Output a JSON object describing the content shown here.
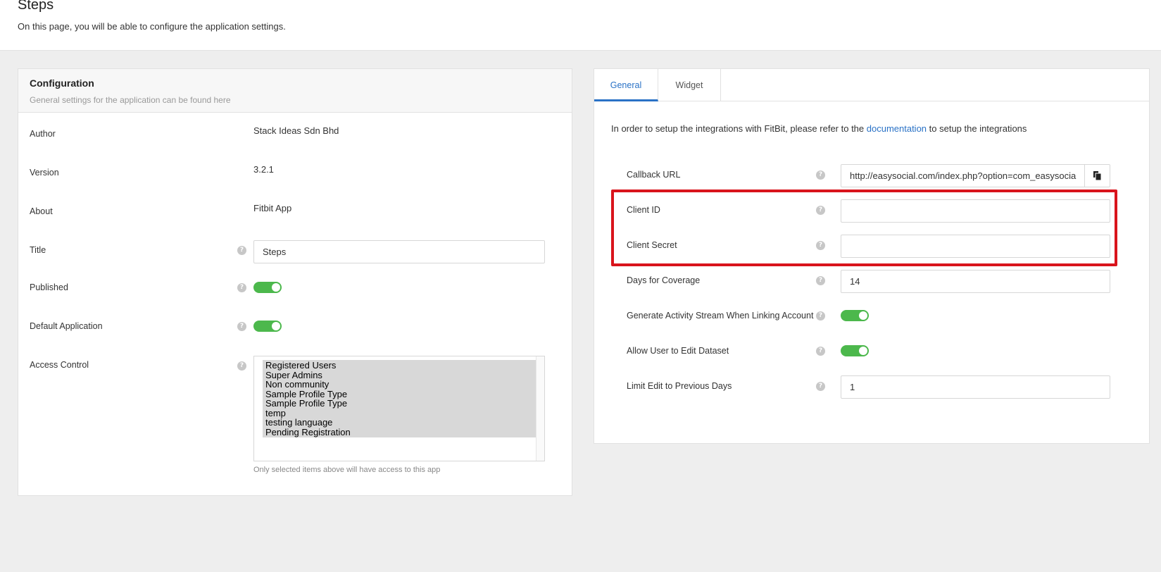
{
  "header": {
    "title": "Steps",
    "description": "On this page, you will be able to configure the application settings."
  },
  "configuration": {
    "title": "Configuration",
    "subtitle": "General settings for the application can be found here",
    "author_label": "Author",
    "author_value": "Stack Ideas Sdn Bhd",
    "version_label": "Version",
    "version_value": "3.2.1",
    "about_label": "About",
    "about_value": "Fitbit App",
    "title_label": "Title",
    "title_value": "Steps",
    "published_label": "Published",
    "published_on": true,
    "default_label": "Default Application",
    "default_on": true,
    "access_label": "Access Control",
    "access_options": [
      "Registered Users",
      "Super Admins",
      "Non community",
      "Sample Profile Type",
      "Sample Profile Type",
      "temp",
      "testing language",
      "Pending Registration"
    ],
    "access_hint": "Only selected items above will have access to this app"
  },
  "tabs": [
    "General",
    "Widget"
  ],
  "active_tab": "General",
  "general": {
    "intro_before": "In order to setup the integrations with FitBit, please refer to the ",
    "intro_link": "documentation",
    "intro_after": " to setup the integrations",
    "callback_label": "Callback URL",
    "callback_value": "http://easysocial.com/index.php?option=com_easysocia",
    "client_id_label": "Client ID",
    "client_id_value": "",
    "client_secret_label": "Client Secret",
    "client_secret_value": "",
    "coverage_label": "Days for Coverage",
    "coverage_value": "14",
    "stream_label": "Generate Activity Stream When Linking Account",
    "stream_on": true,
    "edit_label": "Allow User to Edit Dataset",
    "edit_on": true,
    "limit_label": "Limit Edit to Previous Days",
    "limit_value": "1"
  },
  "colors": {
    "accent": "#2a72c6",
    "toggle_on": "#4cb84c",
    "highlight": "#d9141c"
  }
}
